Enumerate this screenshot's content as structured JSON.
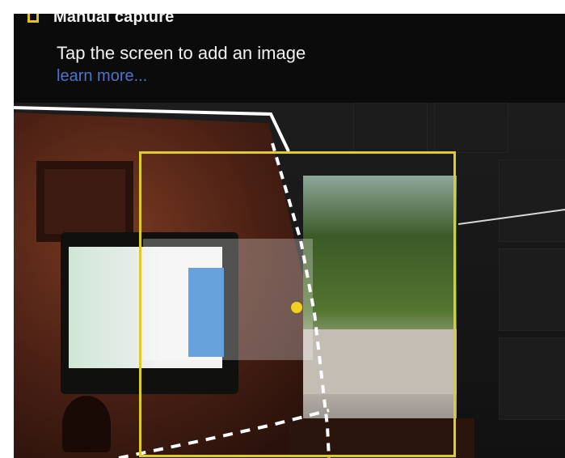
{
  "top_banner": {
    "mode_label": "Manual capture",
    "instruction": "Tap the screen to add an image",
    "learn_more": "learn more..."
  },
  "colors": {
    "accent_yellow": "#dccb2a",
    "link_blue": "#4f74c7",
    "banner_bg": "#0b0b0c"
  },
  "icons": {
    "checkbox": "empty-checkbox-icon"
  }
}
